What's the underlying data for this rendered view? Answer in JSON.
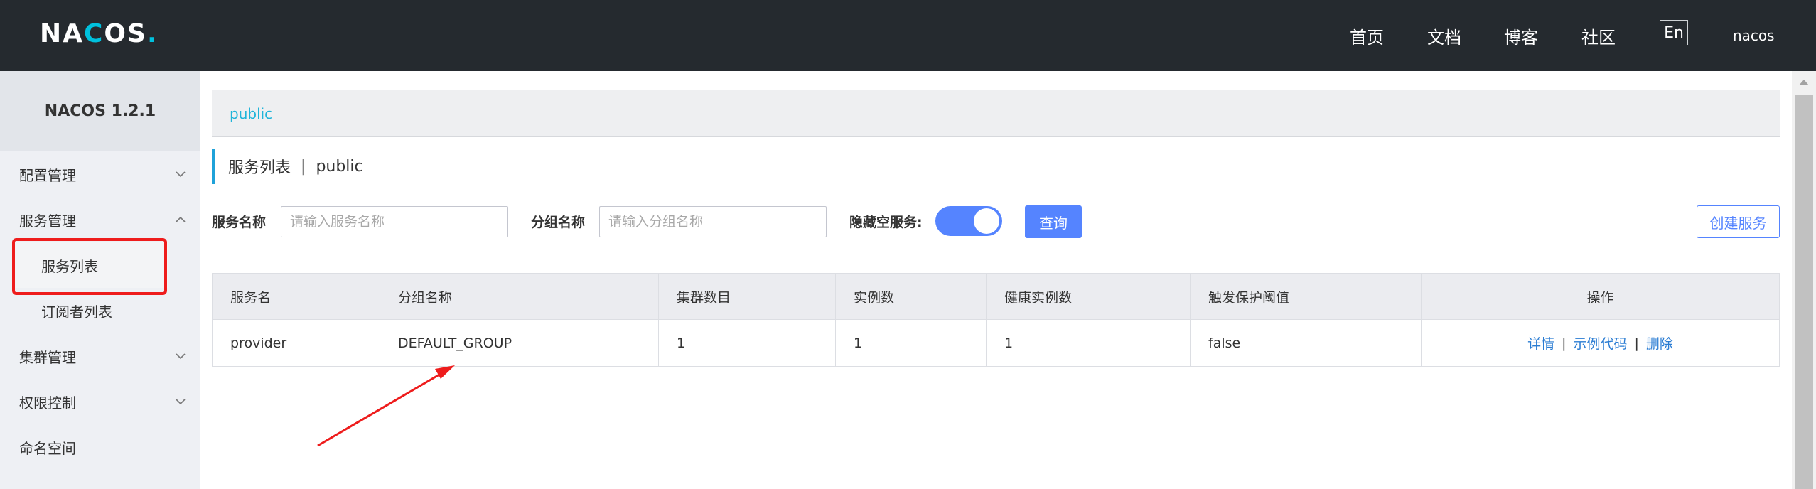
{
  "header": {
    "logo_prefix": "NA",
    "logo_ring": "C",
    "logo_suffix": "OS",
    "logo_dot": ".",
    "nav": [
      "首页",
      "文档",
      "博客",
      "社区"
    ],
    "lang": "En",
    "user": "nacos"
  },
  "sidebar": {
    "brand": "NACOS 1.2.1",
    "items": [
      {
        "label": "配置管理",
        "icon": "chevron-down-icon"
      },
      {
        "label": "服务管理",
        "icon": "chevron-up-icon"
      },
      {
        "label": "服务列表"
      },
      {
        "label": "订阅者列表"
      },
      {
        "label": "集群管理",
        "icon": "chevron-down-icon"
      },
      {
        "label": "权限控制",
        "icon": "chevron-down-icon"
      },
      {
        "label": "命名空间"
      }
    ]
  },
  "breadcrumb": {
    "namespace": "public"
  },
  "page": {
    "title": "服务列表",
    "separator": "|",
    "namespace": "public"
  },
  "filters": {
    "service_name_label": "服务名称",
    "service_name_placeholder": "请输入服务名称",
    "group_name_label": "分组名称",
    "group_name_placeholder": "请输入分组名称",
    "hide_empty_label": "隐藏空服务:",
    "hide_empty_on": true,
    "query_button": "查询",
    "create_button": "创建服务"
  },
  "table": {
    "columns": [
      "服务名",
      "分组名称",
      "集群数目",
      "实例数",
      "健康实例数",
      "触发保护阈值",
      "操作"
    ],
    "rows": [
      {
        "service": "provider",
        "group": "DEFAULT_GROUP",
        "clusters": "1",
        "instances": "1",
        "healthy": "1",
        "threshold": "false",
        "ops": {
          "detail": "详情",
          "sample": "示例代码",
          "delete": "删除",
          "sep": "|"
        }
      }
    ]
  },
  "colors": {
    "header_bg": "#252a2f",
    "accent": "#5584ff",
    "link": "#2a7cd3",
    "highlight": "#ee1c1c"
  }
}
